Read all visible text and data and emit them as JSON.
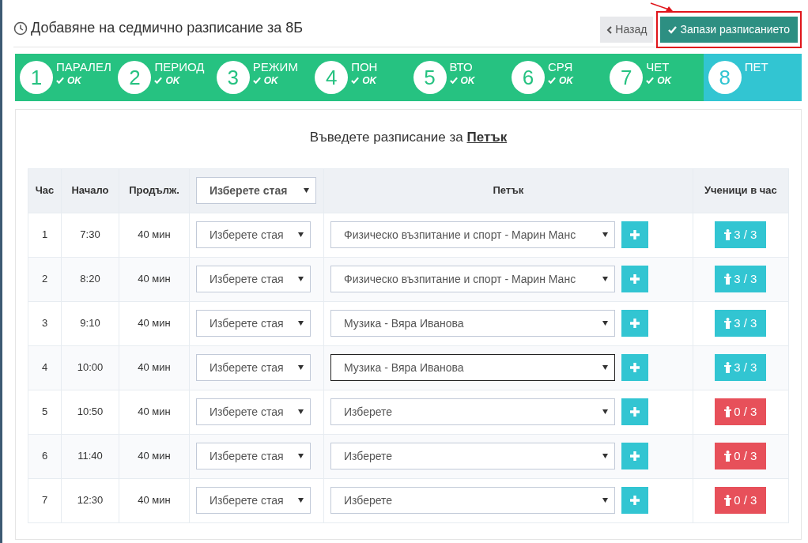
{
  "header": {
    "title": "Добавяне на седмично разписание за 8Б",
    "back_button": "Назад",
    "save_button": "Запази разписанието",
    "save_highlighted": true
  },
  "steps": [
    {
      "number": "1",
      "label": "ПАРАЛЕЛ",
      "status": "OK",
      "selected": false
    },
    {
      "number": "2",
      "label": "ПЕРИОД",
      "status": "OK",
      "selected": false
    },
    {
      "number": "3",
      "label": "РЕЖИМ",
      "status": "OK",
      "selected": false
    },
    {
      "number": "4",
      "label": "ПОН",
      "status": "OK",
      "selected": false
    },
    {
      "number": "5",
      "label": "ВТО",
      "status": "OK",
      "selected": false
    },
    {
      "number": "6",
      "label": "СРЯ",
      "status": "OK",
      "selected": false
    },
    {
      "number": "7",
      "label": "ЧЕТ",
      "status": "OK",
      "selected": false
    },
    {
      "number": "8",
      "label": "ПЕТ",
      "selected": true
    }
  ],
  "prompt": {
    "text": "Въведете разписание за",
    "day": "Петък"
  },
  "table": {
    "columns": [
      "Час",
      "Начало",
      "Продълж.",
      "Петък",
      "Ученици в час"
    ],
    "room_header_select": "Изберете стая",
    "rows": [
      {
        "hour": "1",
        "start": "7:30",
        "duration": "40 мин",
        "room": "Изберете стая",
        "subject": "Физическо възпитание и спорт - Марин Манс",
        "focused": false,
        "students": "3 / 3",
        "kind": "complete"
      },
      {
        "hour": "2",
        "start": "8:20",
        "duration": "40 мин",
        "room": "Изберете стая",
        "subject": "Физическо възпитание и спорт - Марин Манс",
        "focused": false,
        "students": "3 / 3",
        "kind": "complete"
      },
      {
        "hour": "3",
        "start": "9:10",
        "duration": "40 мин",
        "room": "Изберете стая",
        "subject": "Музика - Вяра Иванова",
        "focused": false,
        "students": "3 / 3",
        "kind": "complete"
      },
      {
        "hour": "4",
        "start": "10:00",
        "duration": "40 мин",
        "room": "Изберете стая",
        "subject": "Музика - Вяра Иванова",
        "focused": true,
        "students": "3 / 3",
        "kind": "complete"
      },
      {
        "hour": "5",
        "start": "10:50",
        "duration": "40 мин",
        "room": "Изберете стая",
        "subject": "Изберете",
        "focused": false,
        "students": "0 / 3",
        "kind": "empty"
      },
      {
        "hour": "6",
        "start": "11:40",
        "duration": "40 мин",
        "room": "Изберете стая",
        "subject": "Изберете",
        "focused": false,
        "students": "0 / 3",
        "kind": "empty"
      },
      {
        "hour": "7",
        "start": "12:30",
        "duration": "40 мин",
        "room": "Изберете стая",
        "subject": "Изберете",
        "focused": false,
        "students": "0 / 3",
        "kind": "empty"
      }
    ]
  }
}
